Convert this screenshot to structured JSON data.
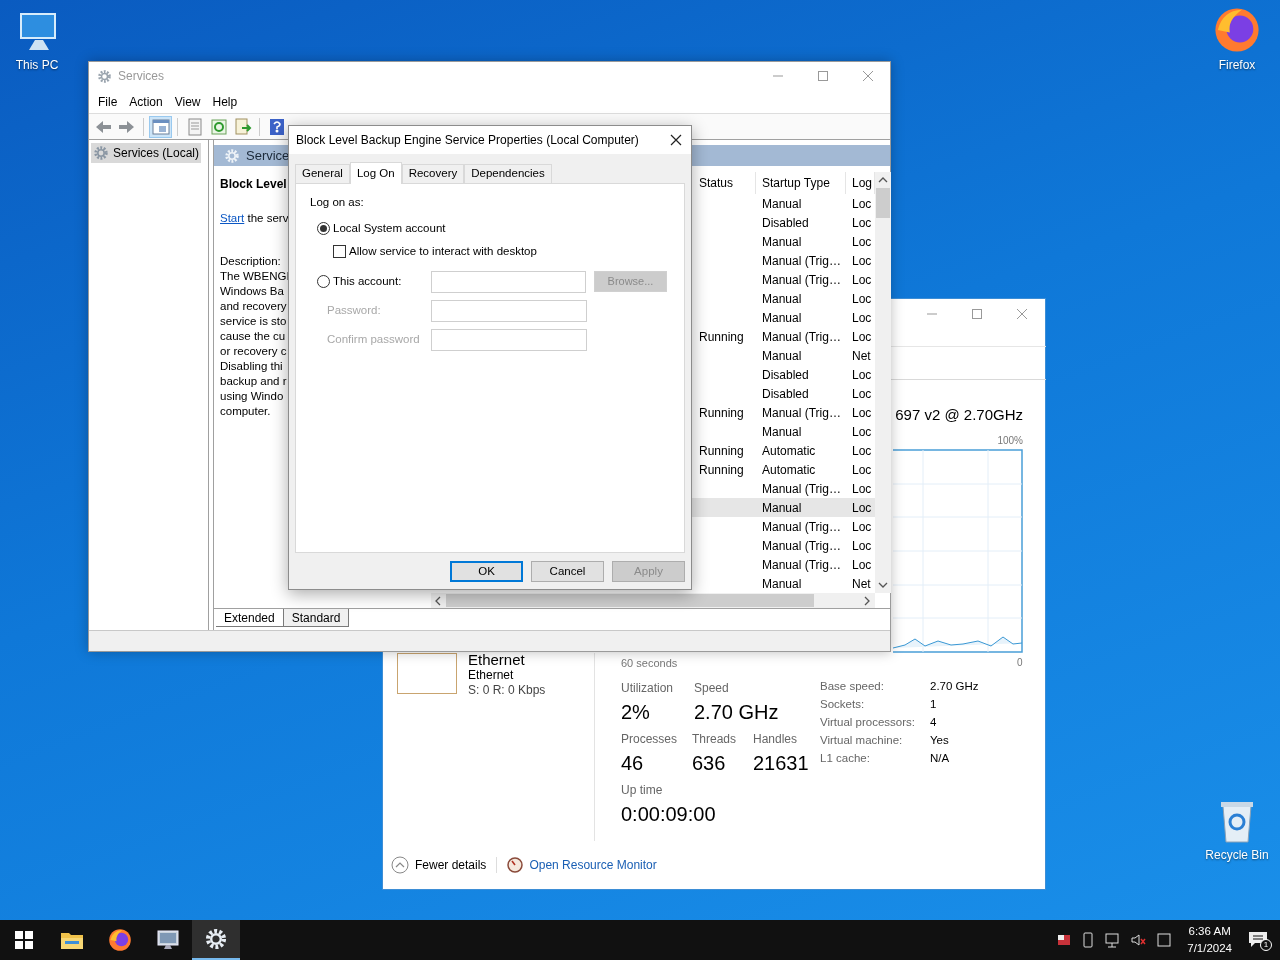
{
  "desktop_icons": [
    {
      "label": "This PC",
      "kind": "pc"
    },
    {
      "label": "Firefox",
      "kind": "firefox"
    },
    {
      "label": "Recycle Bin",
      "kind": "bin"
    }
  ],
  "task_manager": {
    "cpu_model": "697 v2 @ 2.70GHz",
    "graph_max": "100%",
    "graph_min": "0",
    "graph_span": "60 seconds",
    "network": {
      "title": "Ethernet",
      "name": "Ethernet",
      "rate": "S: 0 R: 0 Kbps"
    },
    "stats": [
      {
        "label": "Utilization",
        "value": "2%"
      },
      {
        "label": "Speed",
        "value": "2.70 GHz"
      },
      {
        "label": "Processes",
        "value": "46"
      },
      {
        "label": "Threads",
        "value": "636"
      },
      {
        "label": "Handles",
        "value": "21631"
      },
      {
        "label": "Up time",
        "value": "0:00:09:00"
      }
    ],
    "details": [
      {
        "label": "Base speed:",
        "value": "2.70 GHz"
      },
      {
        "label": "Sockets:",
        "value": "1"
      },
      {
        "label": "Virtual processors:",
        "value": "4"
      },
      {
        "label": "Virtual machine:",
        "value": "Yes"
      },
      {
        "label": "L1 cache:",
        "value": "N/A"
      }
    ],
    "fewer_details": "Fewer details",
    "resource_monitor": "Open Resource Monitor"
  },
  "services": {
    "title": "Services",
    "menu": [
      "File",
      "Action",
      "View",
      "Help"
    ],
    "toolbar": [
      {
        "kind": "back",
        "active": false
      },
      {
        "kind": "forward",
        "active": false
      },
      {
        "kind": "tree",
        "active": true
      },
      {
        "kind": "document",
        "active": false
      },
      {
        "kind": "refresh",
        "active": false
      },
      {
        "kind": "export",
        "active": false
      },
      {
        "kind": "help",
        "active": false
      }
    ],
    "tree": [
      {
        "label": "Services (Local)",
        "selected": true
      }
    ],
    "pane_heading": "Service",
    "detail_title": "Block Level",
    "start_link": "Start",
    "start_rest": "the serv",
    "description_label": "Description:",
    "description_lines": [
      "The WBENGI",
      "Windows Ba",
      "and recovery",
      "service is sto",
      "cause the cu",
      "or recovery c",
      "Disabling thi",
      "backup and r",
      "using Windo",
      "computer."
    ],
    "columns": [
      "Status",
      "Startup Type",
      "Log"
    ],
    "rows": [
      {
        "status": "",
        "startup_type": "Manual",
        "log_on": "Loc",
        "selected": false
      },
      {
        "status": "",
        "startup_type": "Disabled",
        "log_on": "Loc",
        "selected": false
      },
      {
        "status": "",
        "startup_type": "Manual",
        "log_on": "Loc",
        "selected": false
      },
      {
        "status": "",
        "startup_type": "Manual (Trig…",
        "log_on": "Loc",
        "selected": false
      },
      {
        "status": "",
        "startup_type": "Manual (Trig…",
        "log_on": "Loc",
        "selected": false
      },
      {
        "status": "",
        "startup_type": "Manual",
        "log_on": "Loc",
        "selected": false
      },
      {
        "status": "",
        "startup_type": "Manual",
        "log_on": "Loc",
        "selected": false
      },
      {
        "status": "Running",
        "startup_type": "Manual (Trig…",
        "log_on": "Loc",
        "selected": false
      },
      {
        "status": "",
        "startup_type": "Manual",
        "log_on": "Net",
        "selected": false
      },
      {
        "status": "",
        "startup_type": "Disabled",
        "log_on": "Loc",
        "selected": false
      },
      {
        "status": "",
        "startup_type": "Disabled",
        "log_on": "Loc",
        "selected": false
      },
      {
        "status": "Running",
        "startup_type": "Manual (Trig…",
        "log_on": "Loc",
        "selected": false
      },
      {
        "status": "",
        "startup_type": "Manual",
        "log_on": "Loc",
        "selected": false
      },
      {
        "status": "Running",
        "startup_type": "Automatic",
        "log_on": "Loc",
        "selected": false
      },
      {
        "status": "Running",
        "startup_type": "Automatic",
        "log_on": "Loc",
        "selected": false
      },
      {
        "status": "",
        "startup_type": "Manual (Trig…",
        "log_on": "Loc",
        "selected": false
      },
      {
        "status": "",
        "startup_type": "Manual",
        "log_on": "Loc",
        "selected": true
      },
      {
        "status": "",
        "startup_type": "Manual (Trig…",
        "log_on": "Loc",
        "selected": false
      },
      {
        "status": "",
        "startup_type": "Manual (Trig…",
        "log_on": "Loc",
        "selected": false
      },
      {
        "status": "",
        "startup_type": "Manual (Trig…",
        "log_on": "Loc",
        "selected": false
      },
      {
        "status": "",
        "startup_type": "Manual",
        "log_on": "Net",
        "selected": false
      }
    ],
    "view_tabs": [
      {
        "label": "Extended",
        "selected": true
      },
      {
        "label": "Standard",
        "selected": false
      }
    ]
  },
  "dialog": {
    "title": "Block Level Backup Engine Service Properties (Local Computer)",
    "tabs": [
      {
        "label": "General",
        "selected": false
      },
      {
        "label": "Log On",
        "selected": true
      },
      {
        "label": "Recovery",
        "selected": false
      },
      {
        "label": "Dependencies",
        "selected": false
      }
    ],
    "log_on_as": "Log on as:",
    "local_system": {
      "label": "Local System account",
      "selected": true
    },
    "interact": {
      "label": "Allow service to interact with desktop",
      "checked": false
    },
    "this_account": {
      "label": "This account:",
      "selected": false
    },
    "browse": {
      "label": "Browse...",
      "disabled": true
    },
    "fields": [
      {
        "label": "Password:",
        "disabled": true
      },
      {
        "label": "Confirm password",
        "disabled": true
      }
    ],
    "buttons": [
      {
        "label": "OK",
        "default": true,
        "disabled": false
      },
      {
        "label": "Cancel",
        "default": false,
        "disabled": false
      },
      {
        "label": "Apply",
        "default": false,
        "disabled": true
      }
    ]
  },
  "taskbar": {
    "apps": [
      {
        "kind": "start",
        "active": false
      },
      {
        "kind": "folder",
        "active": false
      },
      {
        "kind": "firefox",
        "active": false
      },
      {
        "kind": "monitor",
        "active": false
      },
      {
        "kind": "gear",
        "active": true
      }
    ],
    "time": "6:36 AM",
    "date": "7/1/2024",
    "notifications": "1"
  }
}
